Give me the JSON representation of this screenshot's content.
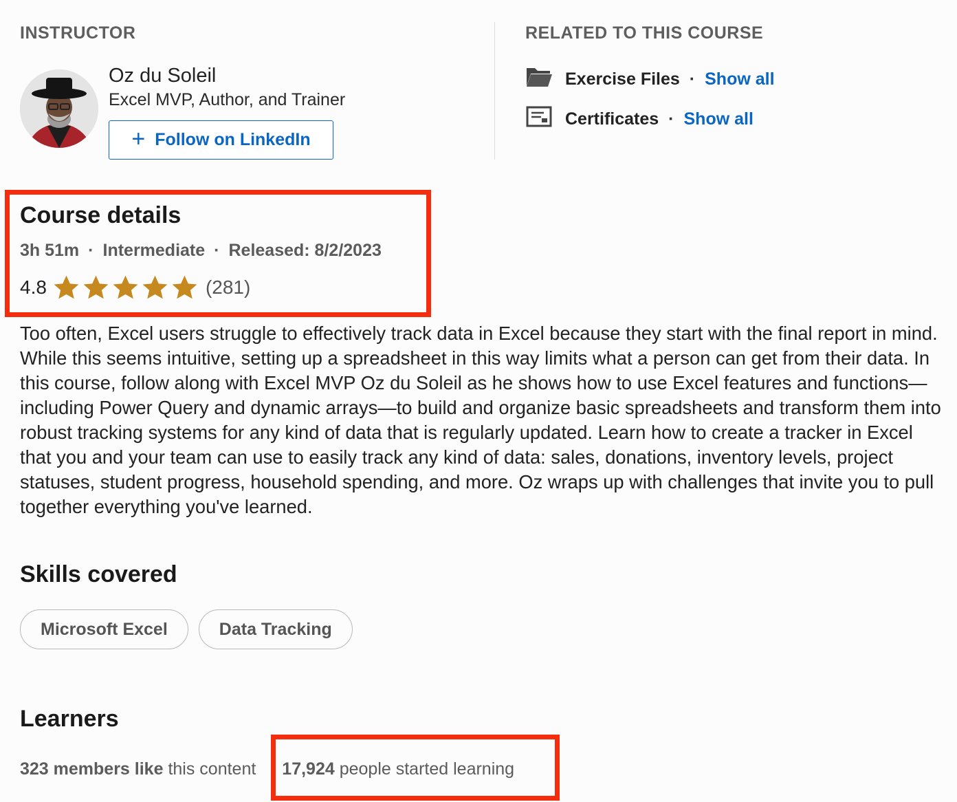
{
  "instructor": {
    "section_label": "INSTRUCTOR",
    "name": "Oz du Soleil",
    "title": "Excel MVP, Author, and Trainer",
    "follow_label": "Follow on LinkedIn"
  },
  "related": {
    "section_label": "RELATED TO THIS COURSE",
    "items": [
      {
        "label": "Exercise Files",
        "link": "Show all",
        "icon": "folder-icon"
      },
      {
        "label": "Certificates",
        "link": "Show all",
        "icon": "certificate-icon"
      }
    ]
  },
  "course_details": {
    "title": "Course details",
    "duration": "3h 51m",
    "level": "Intermediate",
    "released": "Released: 8/2/2023",
    "rating": "4.8",
    "stars": 5,
    "rating_count": "(281)",
    "description": "Too often, Excel users struggle to effectively track data in Excel because they start with the final report in mind. While this seems intuitive, setting up a spreadsheet in this way limits what a person can get from their data. In this course, follow along with Excel MVP Oz du Soleil as he shows how to use Excel features and functions—including Power Query and dynamic arrays—to build and organize basic spreadsheets and transform them into robust tracking systems for any kind of data that is regularly updated. Learn how to create a tracker in Excel that you and your team can use to easily track any kind of data: sales, donations, inventory levels, project statuses, student progress, household spending, and more. Oz wraps up with challenges that invite you to pull together everything you've learned."
  },
  "skills": {
    "title": "Skills covered",
    "items": [
      "Microsoft Excel",
      "Data Tracking"
    ]
  },
  "learners": {
    "title": "Learners",
    "likes_count": "323 members like",
    "likes_suffix": "this content",
    "started_count": "17,924",
    "started_suffix": "people started learning"
  },
  "colors": {
    "link": "#0a66c2",
    "star": "#c6891f",
    "highlight": "#f52d0f"
  }
}
